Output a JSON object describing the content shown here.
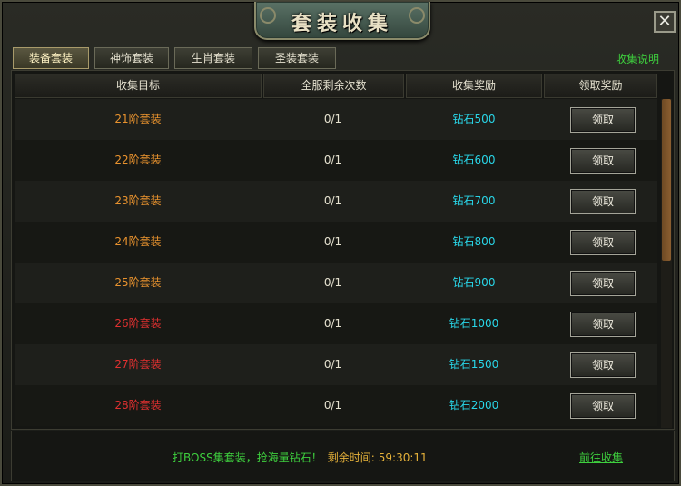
{
  "window": {
    "title": "套装收集",
    "close_label": "✕"
  },
  "tabs": [
    {
      "label": "装备套装",
      "active": true
    },
    {
      "label": "神饰套装",
      "active": false
    },
    {
      "label": "生肖套装",
      "active": false
    },
    {
      "label": "圣装套装",
      "active": false
    }
  ],
  "help_link": "收集说明",
  "columns": [
    "收集目标",
    "全服剩余次数",
    "收集奖励",
    "领取奖励"
  ],
  "rows": [
    {
      "target": "21阶套装",
      "target_color": "#e8922e",
      "remaining": "0/1",
      "reward": "钻石500",
      "button": "领取"
    },
    {
      "target": "22阶套装",
      "target_color": "#e8922e",
      "remaining": "0/1",
      "reward": "钻石600",
      "button": "领取"
    },
    {
      "target": "23阶套装",
      "target_color": "#e8922e",
      "remaining": "0/1",
      "reward": "钻石700",
      "button": "领取"
    },
    {
      "target": "24阶套装",
      "target_color": "#e8922e",
      "remaining": "0/1",
      "reward": "钻石800",
      "button": "领取"
    },
    {
      "target": "25阶套装",
      "target_color": "#e8922e",
      "remaining": "0/1",
      "reward": "钻石900",
      "button": "领取"
    },
    {
      "target": "26阶套装",
      "target_color": "#e03030",
      "remaining": "0/1",
      "reward": "钻石1000",
      "button": "领取"
    },
    {
      "target": "27阶套装",
      "target_color": "#e03030",
      "remaining": "0/1",
      "reward": "钻石1500",
      "button": "领取"
    },
    {
      "target": "28阶套装",
      "target_color": "#e03030",
      "remaining": "0/1",
      "reward": "钻石2000",
      "button": "领取"
    }
  ],
  "footer": {
    "message": "打BOSS集套装，抢海量钻石！",
    "timer_label": "剩余时间:",
    "timer_value": "59:30:11",
    "goto_link": "前往收集"
  },
  "colors": {
    "accent_green": "#3ecf3e",
    "reward_cyan": "#29d6e8",
    "timer_gold": "#e6b23a"
  }
}
